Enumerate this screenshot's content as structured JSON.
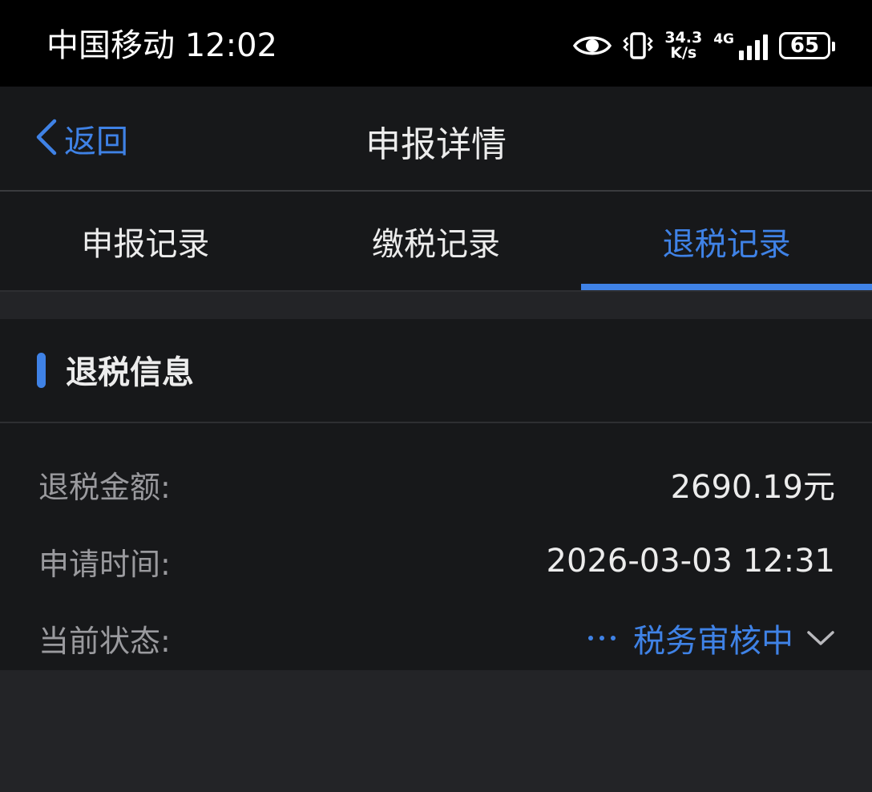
{
  "status_bar": {
    "carrier_time": "中国移动 12:02",
    "net_speed_value": "34.3",
    "net_speed_unit": "K/s",
    "network_type": "4G",
    "battery": "65"
  },
  "nav": {
    "back_label": "返回",
    "title": "申报详情"
  },
  "tabs": [
    {
      "label": "申报记录",
      "active": false
    },
    {
      "label": "缴税记录",
      "active": false
    },
    {
      "label": "退税记录",
      "active": true
    }
  ],
  "refund_info": {
    "section_title": "退税信息",
    "rows": [
      {
        "label": "退税金额:",
        "value": "2690.19元"
      },
      {
        "label": "申请时间:",
        "value": "2026-03-03 12:31"
      },
      {
        "label": "当前状态:",
        "value": "税务审核中"
      }
    ]
  },
  "colors": {
    "accent": "#3f82e6",
    "background": "#17181a",
    "text_primary": "#ececec",
    "text_secondary": "#9a9a9e"
  },
  "icons": {
    "back": "chevron-left-icon",
    "status_expand": "chevron-down-icon",
    "eye": "eye-icon",
    "vibrate": "vibrate-icon"
  }
}
